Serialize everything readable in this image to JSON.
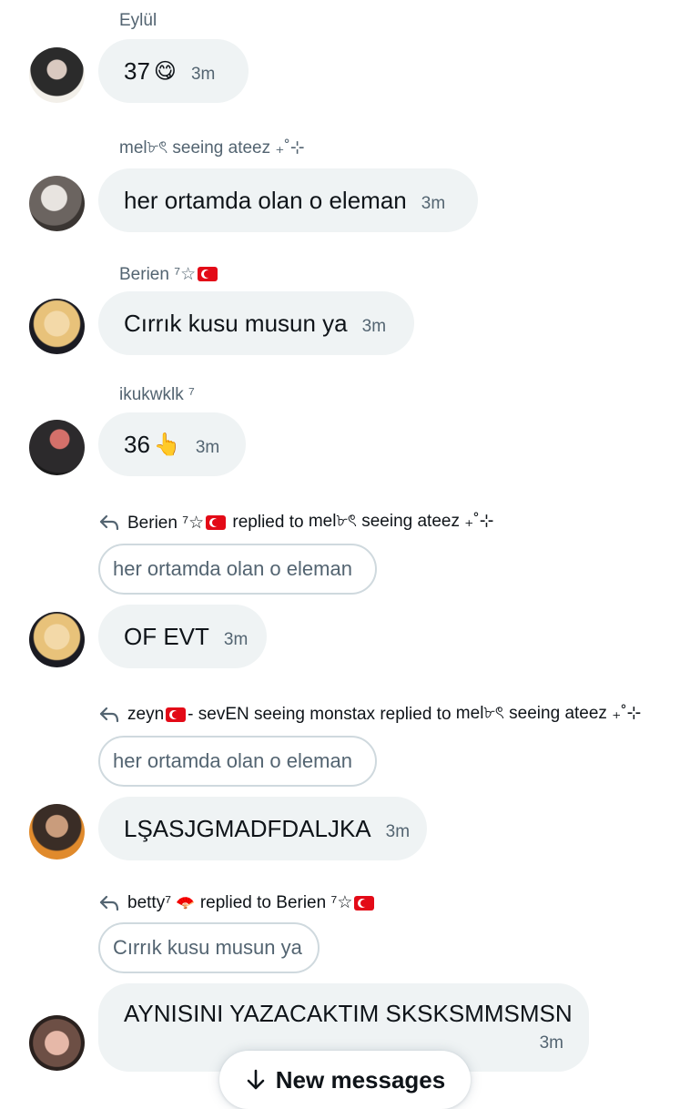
{
  "messages": [
    {
      "sender": "Eylül",
      "text": "37",
      "emoji": "😋",
      "time": "3m"
    },
    {
      "sender": "mel৮ৎ seeing ateez ₊˚⊹",
      "text": "her ortamda olan o eleman",
      "time": "3m"
    },
    {
      "sender": "Berien ⁷☆",
      "text": "Cırrık kusu musun ya",
      "time": "3m"
    },
    {
      "sender": "ikukwklk ⁷",
      "text": "36",
      "emoji": "👆",
      "time": "3m"
    },
    {
      "reply_from": "Berien ⁷☆",
      "reply_to": "mel৮ৎ seeing ateez ₊˚⊹",
      "quote": "her ortamda olan o eleman",
      "text": "OF EVT",
      "time": "3m"
    },
    {
      "reply_from": "zeyn",
      "reply_from_suffix": " - sevEN seeing monstax",
      "reply_to": "mel৮ৎ seeing ateez ₊˚⊹",
      "quote": "her ortamda olan o eleman",
      "text": "LŞASJGMADFDALJKA",
      "time": "3m"
    },
    {
      "reply_from": "betty⁷",
      "reply_from_emoji": "🪭",
      "reply_to": "Berien ⁷☆",
      "quote": "Cırrık kusu musun ya",
      "text": "AYNISINI YAZACAKTIM SKSKSMMSMSN",
      "time": "3m"
    }
  ],
  "replied_to_label": "replied to",
  "new_messages_label": "New messages"
}
